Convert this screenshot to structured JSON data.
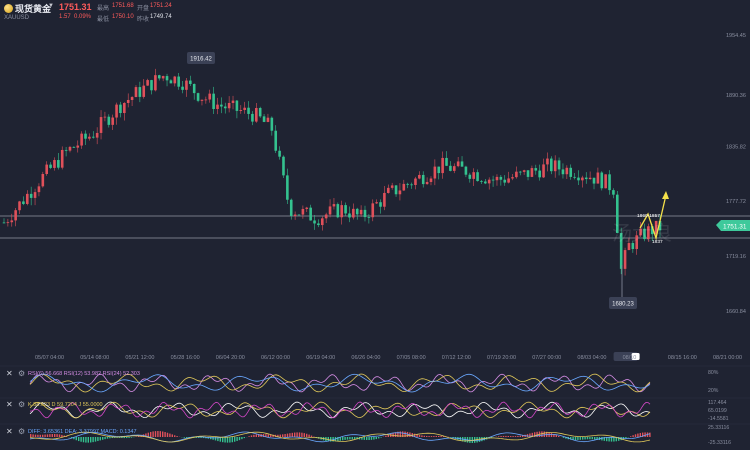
{
  "header": {
    "name": "现货黄金",
    "code": "XAUUSD",
    "last_price": "1751.31",
    "change": "1.57",
    "change_pct": "0.09%",
    "quotes": [
      {
        "label": "最高",
        "value": "1751.68"
      },
      {
        "label": "开盘",
        "value": "1751.24"
      },
      {
        "label": "最低",
        "value": "1750.10"
      },
      {
        "label": "昨收",
        "value": "1749.74"
      }
    ]
  },
  "chart_data": {
    "type": "candlestick",
    "y_ticks": [
      "1954.45",
      "1890.36",
      "1835.82",
      "1777.72",
      "1719.16",
      "1660.84"
    ],
    "x_ticks": [
      "05/07 04:00",
      "05/14 08:00",
      "05/21 12:00",
      "05/28 16:00",
      "06/04 20:00",
      "06/12 00:00",
      "06/19 04:00",
      "06/26 04:00",
      "07/05 08:00",
      "07/12 12:00",
      "07/19 20:00",
      "07/27 00:00",
      "08/03 04:00",
      "08/10",
      "08/15 16:00",
      "08/21 00:00"
    ],
    "current_price_tag": "1751.31",
    "annotations": {
      "high": "1916.42",
      "low": "1680.23",
      "resistance": "1860-1857",
      "support": "1837"
    },
    "watermark": "汤大良",
    "trend_points": [
      [
        0,
        1755
      ],
      [
        8,
        1800
      ],
      [
        14,
        1830
      ],
      [
        20,
        1850
      ],
      [
        26,
        1880
      ],
      [
        32,
        1900
      ],
      [
        36,
        1912
      ],
      [
        40,
        1905
      ],
      [
        44,
        1890
      ],
      [
        48,
        1880
      ],
      [
        52,
        1875
      ],
      [
        56,
        1870
      ],
      [
        60,
        1855
      ],
      [
        64,
        1770
      ],
      [
        70,
        1760
      ],
      [
        76,
        1770
      ],
      [
        80,
        1760
      ],
      [
        86,
        1785
      ],
      [
        92,
        1800
      ],
      [
        98,
        1815
      ],
      [
        104,
        1810
      ],
      [
        110,
        1800
      ],
      [
        116,
        1805
      ],
      [
        122,
        1815
      ],
      [
        128,
        1810
      ],
      [
        134,
        1800
      ],
      [
        137,
        1790
      ],
      [
        138,
        1700
      ],
      [
        140,
        1730
      ],
      [
        144,
        1745
      ],
      [
        147,
        1750
      ]
    ],
    "indicators": [
      {
        "name": "RSI",
        "label": "RSI(6) 56.668  RSI(12) 53.982  RSI(24) 52.303",
        "ticks": [
          "80%",
          "20%"
        ]
      },
      {
        "name": "KDJ",
        "label": "K 58.623  D 59.7204  J 55.0000",
        "ticks": [
          "117.464",
          "65.0199",
          "-14.5581"
        ]
      },
      {
        "name": "MACD",
        "label": "DIFF: 3.65361  DEA: 3.37997  MACD: 0.1347",
        "ticks": [
          "25.33116",
          "-25.33116"
        ]
      }
    ]
  }
}
